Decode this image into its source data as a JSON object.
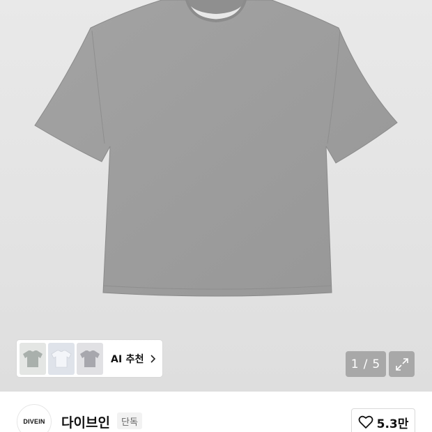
{
  "product_gallery": {
    "image_alt": "Grey short-sleeve t-shirt",
    "counter_current": "1",
    "counter_separator": "/",
    "counter_total": "5",
    "expand_icon": "expand-icon"
  },
  "ai_recommend": {
    "label": "AI 추천",
    "chevron_icon": "chevron-right-icon",
    "thumbnails": [
      {
        "color": "#a9b0ac"
      },
      {
        "color": "#d7dbe2"
      },
      {
        "color": "#a7a7ad"
      }
    ]
  },
  "brand": {
    "logo_text": "DIVEIN",
    "name": "다이브인",
    "tag": "단독"
  },
  "like": {
    "icon": "heart-icon",
    "count": "5.3만"
  }
}
